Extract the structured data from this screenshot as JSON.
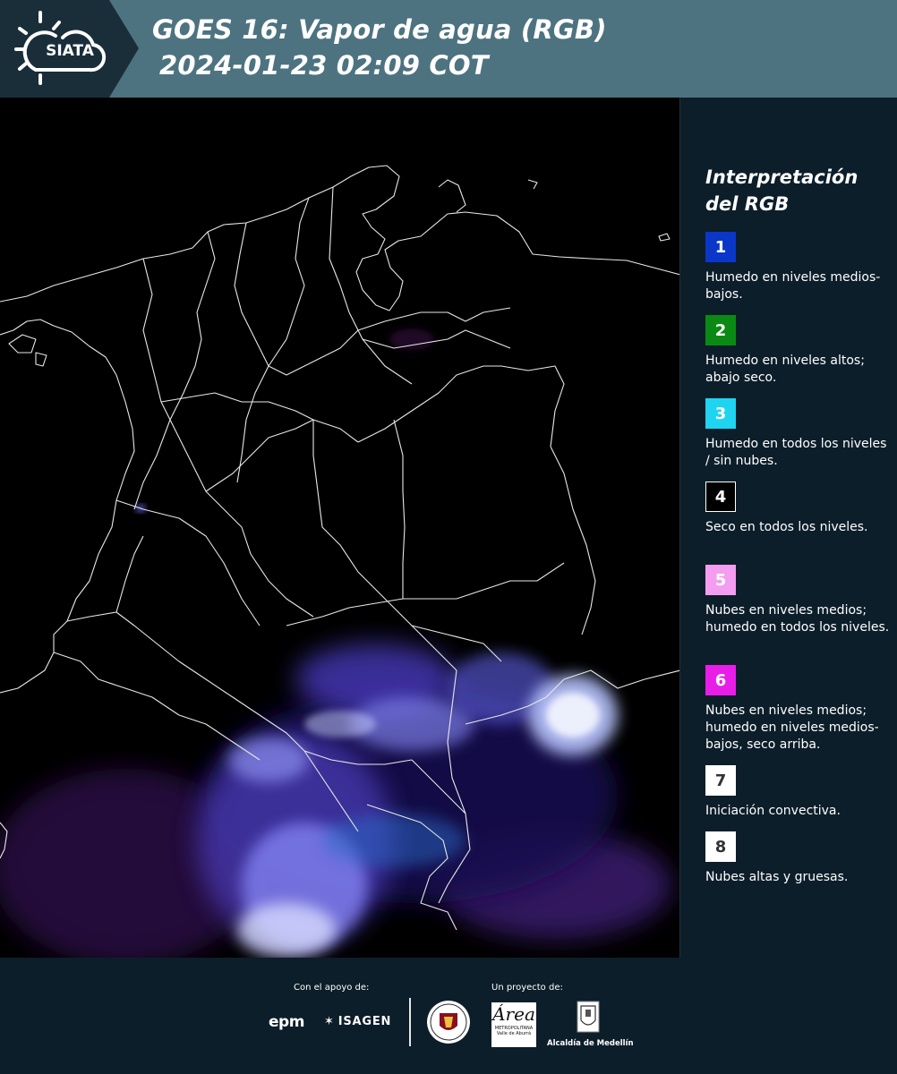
{
  "header": {
    "logo_text": "SIATA",
    "title_line1": "GOES 16: Vapor de agua (RGB)",
    "title_line2": "2024-01-23 02:09 COT"
  },
  "legend": {
    "title": "Interpretación del RGB",
    "items": [
      {
        "number": "1",
        "color": "#0a37c8",
        "number_color": "#ffffff",
        "text": "Humedo en niveles medios-bajos."
      },
      {
        "number": "2",
        "color": "#0a8a14",
        "number_color": "#ffffff",
        "text": "Humedo en niveles altos; abajo seco."
      },
      {
        "number": "3",
        "color": "#1fd4f0",
        "number_color": "#ffffff",
        "text": "Humedo en todos los niveles / sin nubes."
      },
      {
        "number": "4",
        "color": "#000000",
        "number_color": "#ffffff",
        "text": "Seco en todos los niveles."
      },
      {
        "number": "5",
        "color": "#f49cf0",
        "number_color": "#ffffff",
        "text": "Nubes en niveles medios; humedo en todos los niveles."
      },
      {
        "number": "6",
        "color": "#e81ee8",
        "number_color": "#ffffff",
        "text": "Nubes en niveles medios; humedo en niveles medios-bajos, seco arriba."
      },
      {
        "number": "7",
        "color": "#ffffff",
        "number_color": "#333333",
        "text": "Iniciación convectiva."
      },
      {
        "number": "8",
        "color": "#ffffff",
        "number_color": "#333333",
        "text": "Nubes altas y gruesas."
      }
    ]
  },
  "footer": {
    "support_caption": "Con el apoyo de:",
    "project_caption": "Un proyecto de:",
    "epm_label": "epm",
    "isagen_label": "ISAGEN",
    "area_metro_mark": "Área",
    "area_metro_sub": "METROPOLITANA Valle de Aburrá",
    "alcaldia_label": "Alcaldía de Medellín"
  }
}
